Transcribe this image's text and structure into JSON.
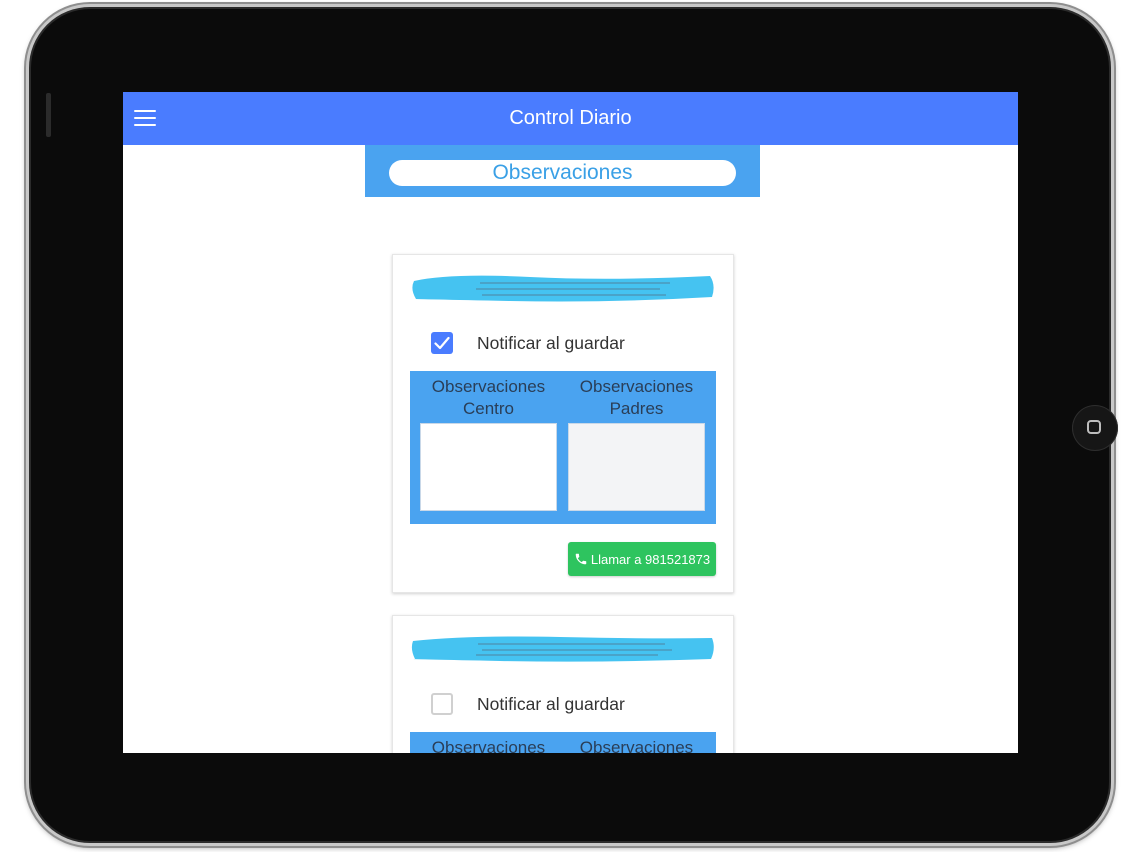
{
  "app": {
    "title": "Control Diario",
    "menu_icon": "hamburger-menu-icon"
  },
  "section": {
    "label": "Observaciones"
  },
  "colors": {
    "topbar": "#4a7cff",
    "section_tab": "#4aa3f0",
    "panel": "#4aa3f0",
    "call_button": "#2ec45f",
    "name_brush": "#45c3f1"
  },
  "cards": [
    {
      "notify_label": "Notificar al guardar",
      "notify_checked": true,
      "obs_centro_label": "Observaciones Centro",
      "obs_padres_label": "Observaciones Padres",
      "obs_centro_value": "",
      "obs_padres_value": "",
      "call_label": "Llamar a 981521873",
      "call_icon": "phone-icon"
    },
    {
      "notify_label": "Notificar al guardar",
      "notify_checked": false,
      "obs_centro_label": "Observaciones Centro",
      "obs_padres_label": "Observaciones Padres"
    }
  ]
}
